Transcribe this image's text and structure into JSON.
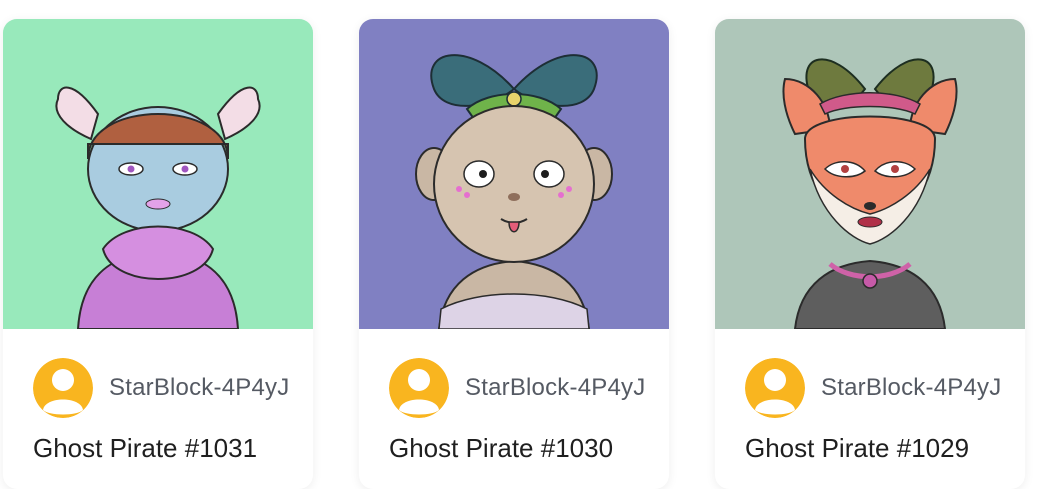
{
  "cards": [
    {
      "owner": "StarBlock-4P4yJ",
      "title": "Ghost Pirate #1031",
      "background_color": "#8fe6b4"
    },
    {
      "owner": "StarBlock-4P4yJ",
      "title": "Ghost Pirate #1030",
      "background_color": "#8080c2"
    },
    {
      "owner": "StarBlock-4P4yJ",
      "title": "Ghost Pirate #1029",
      "background_color": "#a7c0b3"
    }
  ],
  "avatar_color": "#f9b51f",
  "icons": {
    "avatar": "user-silhouette-icon"
  }
}
